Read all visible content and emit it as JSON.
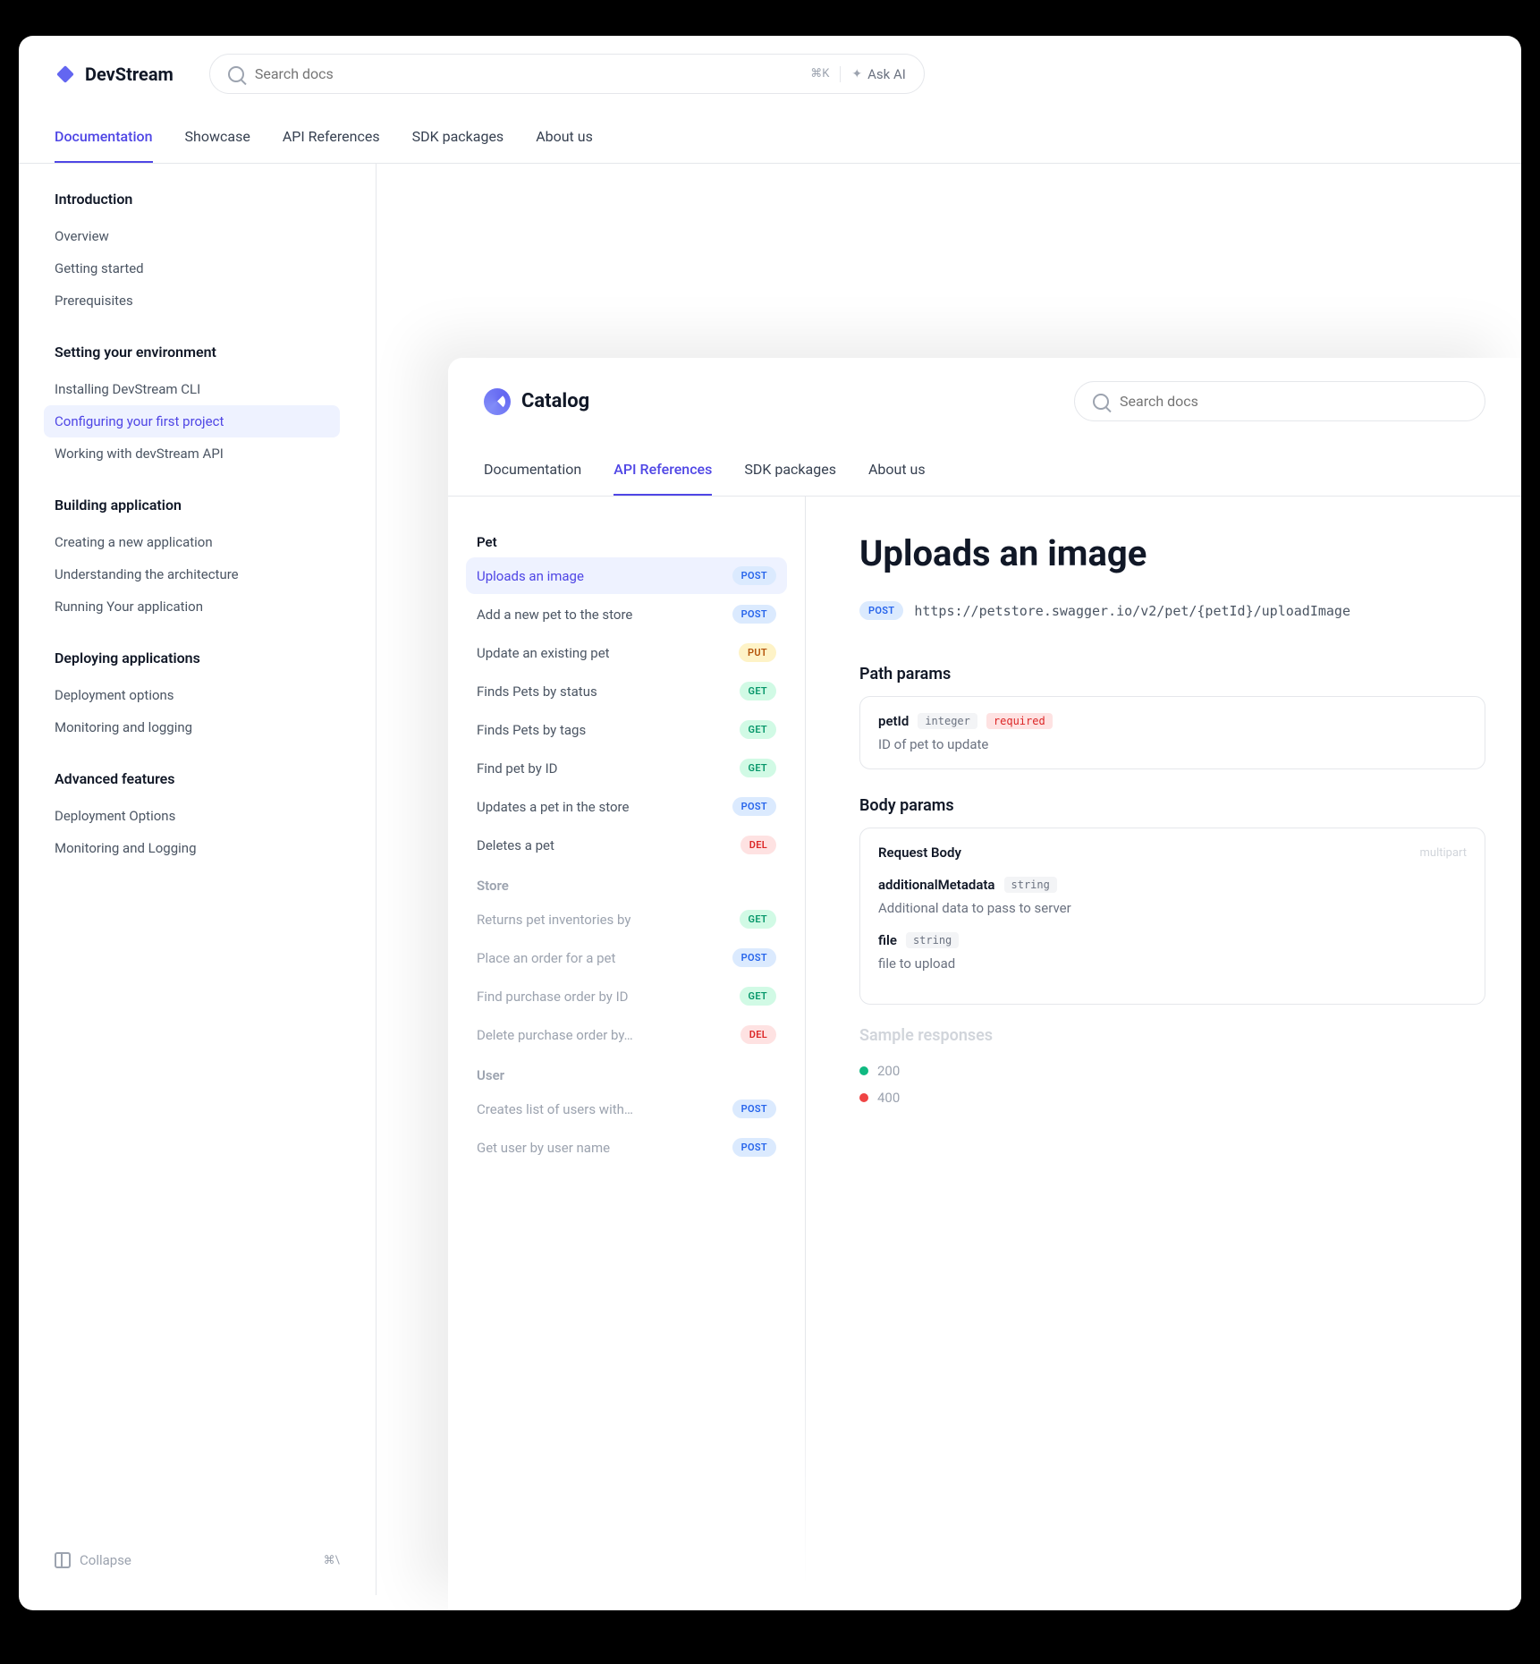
{
  "brand": "DevStream",
  "search": {
    "placeholder": "Search docs",
    "kbd": "⌘K",
    "ask_ai": "Ask AI"
  },
  "top_tabs": [
    "Documentation",
    "Showcase",
    "API References",
    "SDK packages",
    "About us"
  ],
  "top_tabs_active": 0,
  "sidebar": {
    "sections": [
      {
        "title": "Introduction",
        "items": [
          "Overview",
          "Getting started",
          "Prerequisites"
        ],
        "active": -1
      },
      {
        "title": "Setting your environment",
        "items": [
          "Installing DevStream CLI",
          "Configuring your first project",
          "Working with devStream API"
        ],
        "active": 1
      },
      {
        "title": "Building application",
        "items": [
          "Creating a new application",
          "Understanding the architecture",
          "Running Your application"
        ],
        "active": -1
      },
      {
        "title": "Deploying applications",
        "items": [
          "Deployment options",
          "Monitoring and logging"
        ],
        "active": -1
      },
      {
        "title": "Advanced features",
        "items": [
          "Deployment Options",
          "Monitoring and Logging"
        ],
        "active": -1
      }
    ],
    "collapse": {
      "label": "Collapse",
      "kbd": "⌘\\"
    }
  },
  "catalog": {
    "name": "Catalog",
    "search_placeholder": "Search docs",
    "tabs": [
      "Documentation",
      "API References",
      "SDK packages",
      "About us"
    ],
    "tabs_active": 1,
    "api_sections": [
      {
        "title": "Pet",
        "faded": false,
        "items": [
          {
            "label": "Uploads an image",
            "method": "POST",
            "active": true
          },
          {
            "label": "Add a new pet to the store",
            "method": "POST"
          },
          {
            "label": "Update an existing pet",
            "method": "PUT"
          },
          {
            "label": "Finds Pets by status",
            "method": "GET"
          },
          {
            "label": "Finds Pets by tags",
            "method": "GET"
          },
          {
            "label": "Find pet by ID",
            "method": "GET"
          },
          {
            "label": "Updates a pet in the store",
            "method": "POST"
          },
          {
            "label": "Deletes a pet",
            "method": "DEL"
          }
        ]
      },
      {
        "title": "Store",
        "faded": true,
        "items": [
          {
            "label": "Returns pet inventories by",
            "method": "GET"
          },
          {
            "label": "Place an order for a pet",
            "method": "POST"
          },
          {
            "label": "Find purchase order by ID",
            "method": "GET"
          },
          {
            "label": "Delete purchase order by…",
            "method": "DEL"
          }
        ]
      },
      {
        "title": "User",
        "faded": true,
        "items": [
          {
            "label": "Creates list of users with…",
            "method": "POST"
          },
          {
            "label": "Get user by user name",
            "method": "POST"
          }
        ]
      }
    ],
    "content": {
      "title": "Uploads an image",
      "method": "POST",
      "url": "https://petstore.swagger.io/v2/pet/{petId}/uploadImage",
      "path_params_title": "Path params",
      "path_params": [
        {
          "name": "petId",
          "type": "integer",
          "required": "required",
          "desc": "ID of pet to update"
        }
      ],
      "body_params_title": "Body params",
      "request_body_label": "Request Body",
      "content_type": "multipart",
      "body_params": [
        {
          "name": "additionalMetadata",
          "type": "string",
          "desc": "Additional data to pass to server"
        },
        {
          "name": "file",
          "type": "string",
          "desc": "file to upload"
        }
      ],
      "sample_responses_title": "Sample responses",
      "responses": [
        {
          "code": "200",
          "color": "green"
        },
        {
          "code": "400",
          "color": "red"
        }
      ]
    }
  }
}
